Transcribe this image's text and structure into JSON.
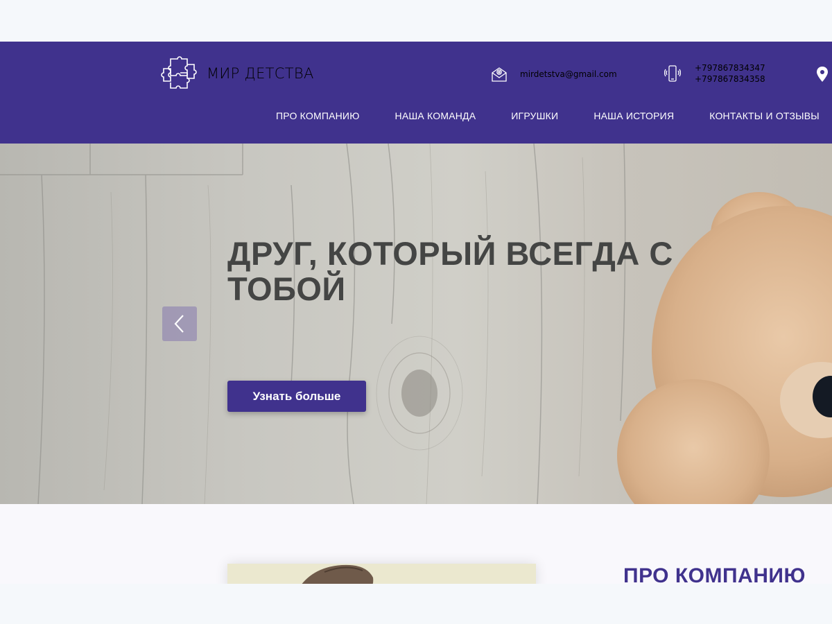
{
  "brand": {
    "name": "МИР ДЕТСТВА",
    "logo_icon": "puzzle-icon"
  },
  "contacts": {
    "email": "mirdetstva@gmail.com",
    "email_icon": "envelope-icon",
    "phones": [
      "+797867834347",
      "+797867834358"
    ],
    "phone_icon": "smartphone-icon",
    "location_icon": "map-pin-icon"
  },
  "nav": {
    "items": [
      "ПРО КОМПАНИЮ",
      "НАША КОМАНДА",
      "ИГРУШКИ",
      "НАША ИСТОРИЯ",
      "КОНТАКТЫ И ОТЗЫВЫ"
    ]
  },
  "hero": {
    "title": "ДРУГ, КОТОРЫЙ ВСЕГДА С ТОБОЙ",
    "button_label": "Узнать больше",
    "prev_icon": "chevron-left-icon"
  },
  "about": {
    "title": "ПРО КОМПАНИЮ"
  },
  "colors": {
    "brand": "#40328d",
    "hero_text": "#444544",
    "page_bg": "#f5f8fb"
  }
}
